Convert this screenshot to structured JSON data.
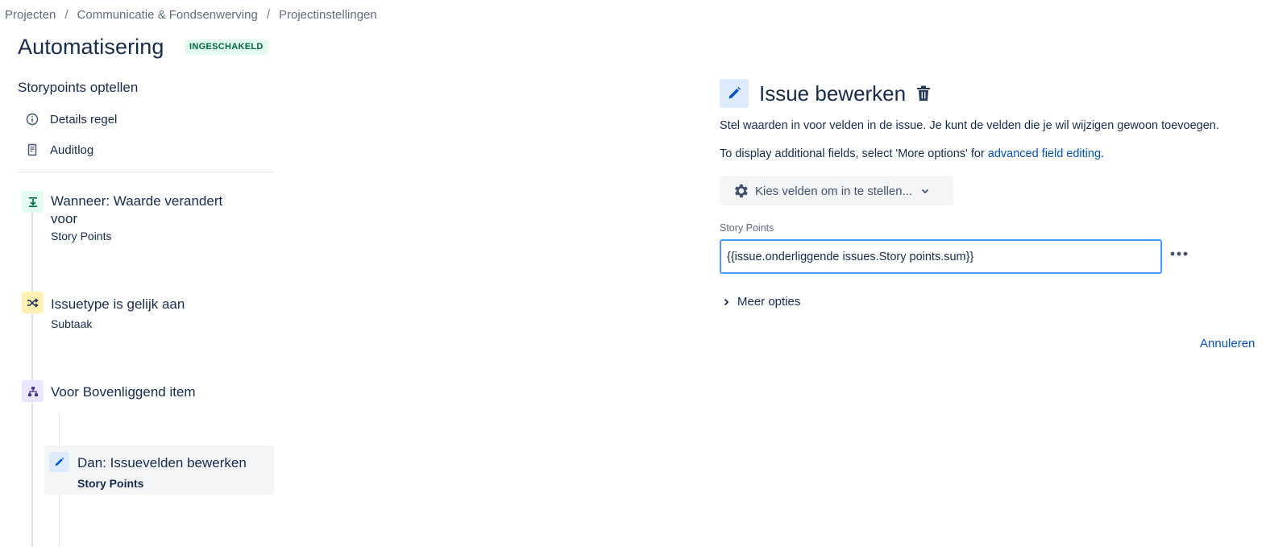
{
  "breadcrumb": {
    "items": [
      "Projecten",
      "Communicatie & Fondsenwerving",
      "Projectinstellingen"
    ],
    "separator": "/"
  },
  "header": {
    "title": "Automatisering",
    "status": "INGESCHAKELD"
  },
  "sidebar": {
    "rule_name": "Storypoints optellen",
    "links": [
      {
        "label": "Details regel",
        "icon": "info-icon"
      },
      {
        "label": "Auditlog",
        "icon": "document-icon"
      }
    ],
    "components": [
      {
        "title_line1": "Wanneer: Waarde verandert",
        "title_line2": "voor",
        "subtitle": "Story Points",
        "icon": "trigger-icon",
        "icon_color": "#e3fcef"
      },
      {
        "title": "Issuetype is gelijk aan",
        "subtitle": "Subtaak",
        "icon": "shuffle-icon",
        "icon_color": "#fff0b3"
      },
      {
        "title": "Voor Bovenliggend item",
        "icon": "hierarchy-icon",
        "icon_color": "#eae6ff"
      },
      {
        "title": "Dan: Issuevelden bewerken",
        "subtitle": "Story Points",
        "icon": "pencil-icon",
        "icon_color": "#deebff"
      }
    ]
  },
  "panel": {
    "title": "Issue bewerken",
    "description1": "Stel waarden in voor velden in de issue. Je kunt de velden die je wil wijzigen gewoon toevoegen.",
    "description2_prefix": "To display additional fields, select 'More options' for ",
    "description2_link": "advanced field editing",
    "description2_suffix": ".",
    "choose_fields_label": "Kies velden om in te stellen...",
    "field_label": "Story Points",
    "field_value": "{{issue.onderliggende issues.Story points.sum}}",
    "more_options_label": "Meer opties",
    "cancel_label": "Annuleren"
  },
  "colors": {
    "accent": "#0052cc",
    "focus_border": "#4c9aff",
    "enabled_bg": "#e3fcef",
    "enabled_text": "#006644"
  }
}
